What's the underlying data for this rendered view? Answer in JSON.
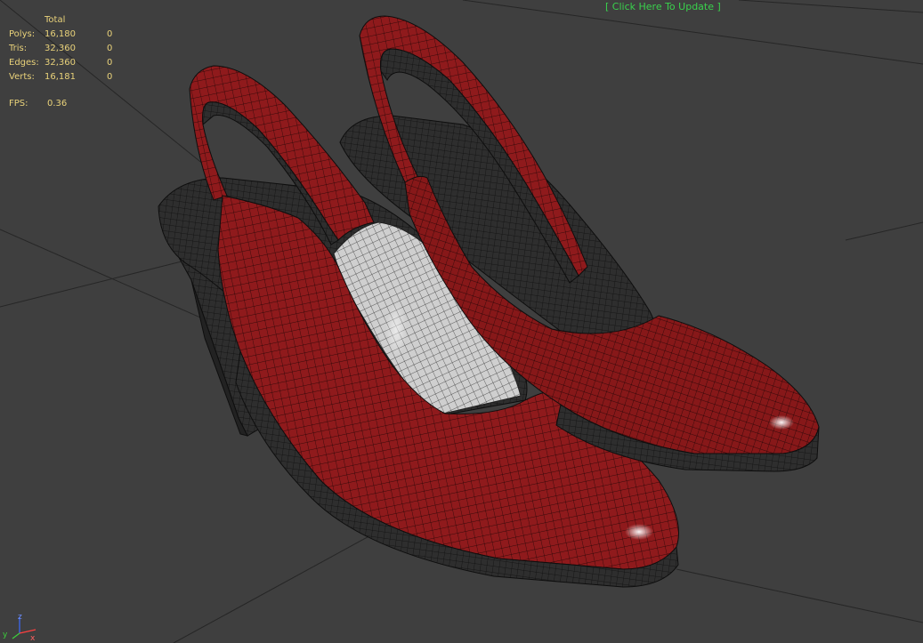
{
  "stats": {
    "header": "Total",
    "rows": [
      {
        "label": "Polys:",
        "total": "16,180",
        "selected": "0"
      },
      {
        "label": "Tris:",
        "total": "32,360",
        "selected": "0"
      },
      {
        "label": "Edges:",
        "total": "32,360",
        "selected": "0"
      },
      {
        "label": "Verts:",
        "total": "16,181",
        "selected": "0"
      }
    ],
    "fps_label": "FPS:",
    "fps_value": "0.36"
  },
  "update_link": "[ Click Here To Update ]",
  "axis": {
    "z": "z",
    "y": "y",
    "x": "x"
  },
  "colors": {
    "viewport_bg": "#3f3f3f",
    "grid_line": "#2a2a2a",
    "stats_text": "#e9d27a",
    "update_text": "#39d14c",
    "shoe_red": "#8f1a1c",
    "insole_light": "#d9d9d9",
    "wire": "#111111"
  },
  "icons": {
    "axis": "axis-tripod-icon"
  }
}
